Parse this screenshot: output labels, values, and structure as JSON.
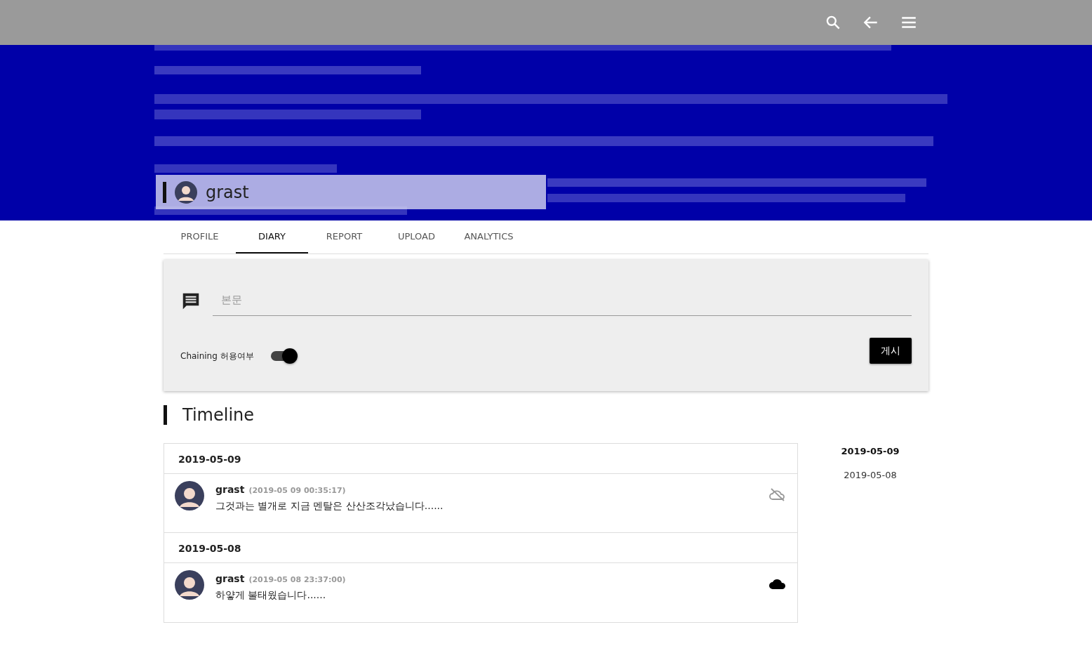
{
  "profile": {
    "name": "grast"
  },
  "tabs": [
    {
      "label": "PROFILE",
      "selected": false
    },
    {
      "label": "DIARY",
      "selected": true
    },
    {
      "label": "REPORT",
      "selected": false
    },
    {
      "label": "UPLOAD",
      "selected": false
    },
    {
      "label": "ANALYTICS",
      "selected": false
    }
  ],
  "composer": {
    "placeholder": "본문",
    "toggle_label": "Chaining 허용여부",
    "chaining": true,
    "submit": "게시"
  },
  "timeline": {
    "title": "Timeline",
    "groups": [
      {
        "date": "2019-05-09",
        "posts": [
          {
            "author": "grast",
            "time": "(2019-05 09 00:35:17)",
            "text": "그것과는 별개로 지금 멘탈은 산산조각났습니다......",
            "synced": false
          }
        ]
      },
      {
        "date": "2019-05-08",
        "posts": [
          {
            "author": "grast",
            "time": "(2019-05 08 23:37:00)",
            "text": "하얗게 불태웠습니다......",
            "synced": true
          }
        ]
      }
    ]
  },
  "date_nav": [
    {
      "label": "2019-05-09",
      "selected": true
    },
    {
      "label": "2019-05-08",
      "selected": false
    }
  ]
}
